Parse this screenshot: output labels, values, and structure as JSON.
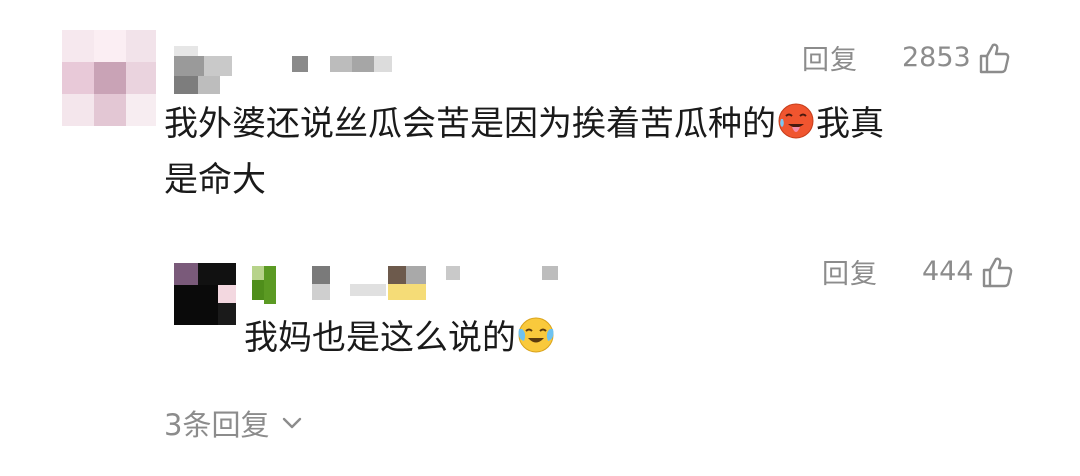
{
  "comment": {
    "reply_label": "回复",
    "likes": "2853",
    "text_line1": "我外婆还说丝瓜会苦是因为挨着苦瓜种的",
    "text_line1_tail": "我真",
    "text_line2": "是命大",
    "emoji_icon": "hot-face-icon"
  },
  "reply": {
    "reply_label": "回复",
    "likes": "444",
    "text": "我妈也是这么说的",
    "emoji_icon": "face-with-tears-icon"
  },
  "more_replies": "3条回复",
  "colors": {
    "meta_gray": "#8c8c8c",
    "text": "#1a1a1a"
  }
}
